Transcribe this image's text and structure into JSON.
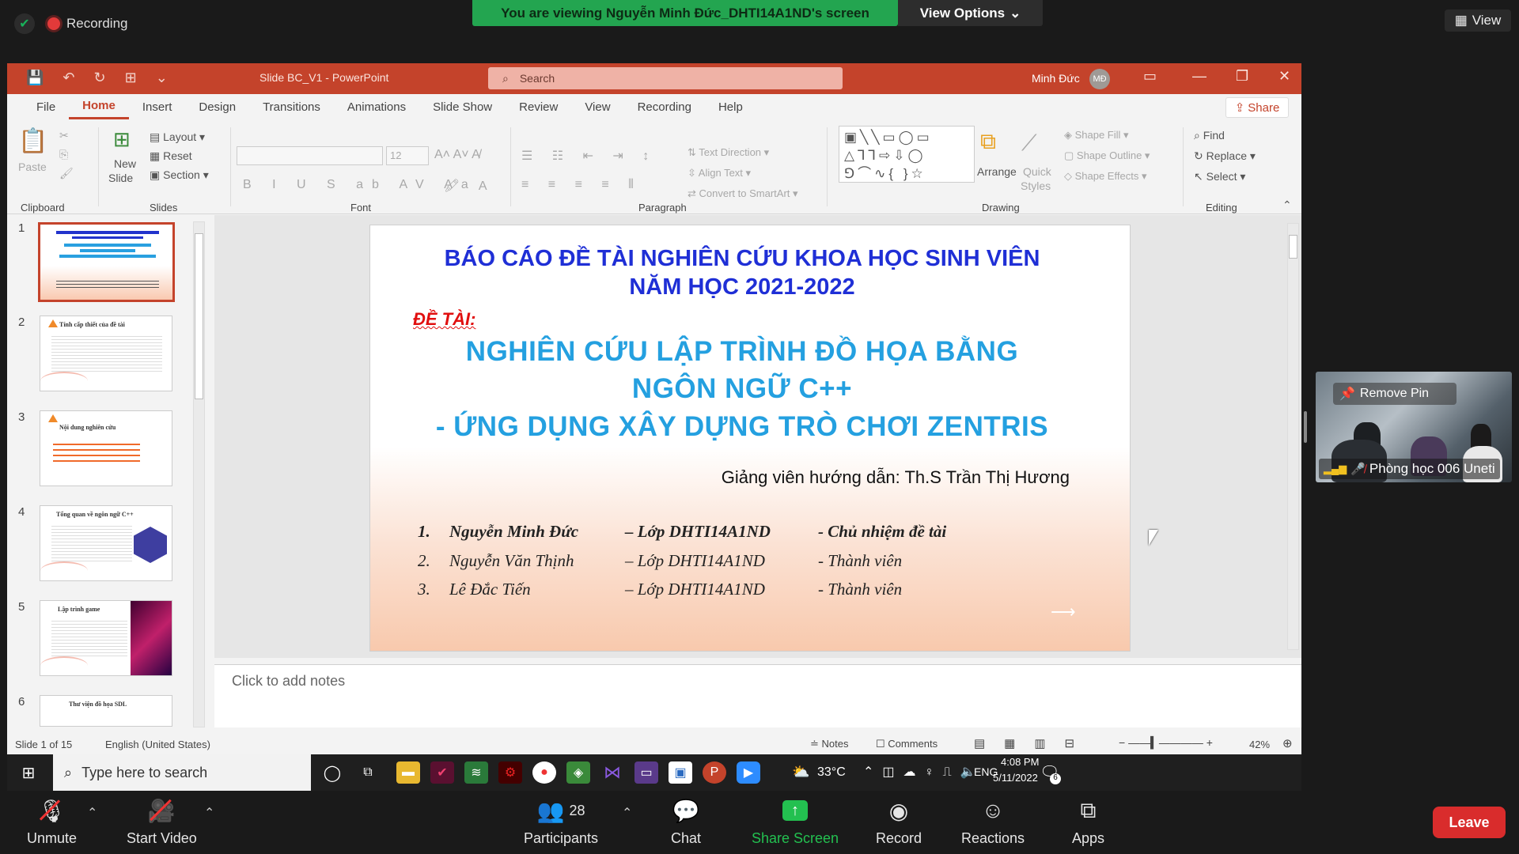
{
  "zoom": {
    "recording_label": "Recording",
    "banner": "You are viewing Nguyễn Minh Đức_DHTI14A1ND's screen",
    "view_options": "View Options",
    "view_label": "View",
    "leave": "Leave",
    "participants_count": "28",
    "controls": {
      "unmute": "Unmute",
      "start_video": "Start Video",
      "participants": "Participants",
      "chat": "Chat",
      "share_screen": "Share Screen",
      "record": "Record",
      "reactions": "Reactions",
      "apps": "Apps"
    },
    "video_tile": {
      "remove_pin": "Remove Pin",
      "name": "Phòng học 006 Uneti"
    }
  },
  "ppt": {
    "doc_title": "Slide BC_V1  -  PowerPoint",
    "search_placeholder": "Search",
    "user_name": "Minh Đức",
    "user_initials": "MĐ",
    "tabs": [
      "File",
      "Home",
      "Insert",
      "Design",
      "Transitions",
      "Animations",
      "Slide Show",
      "Review",
      "View",
      "Recording",
      "Help"
    ],
    "share": "Share",
    "ribbon": {
      "paste": "Paste",
      "new_slide": "New",
      "new_slide2": "Slide",
      "layout": "Layout",
      "reset": "Reset",
      "section": "Section",
      "font_size": "12",
      "text_direction": "Text Direction",
      "align_text": "Align Text",
      "convert_smartart": "Convert to SmartArt",
      "arrange": "Arrange",
      "quick_styles": "Quick",
      "quick_styles2": "Styles",
      "shape_fill": "Shape Fill",
      "shape_outline": "Shape Outline",
      "shape_effects": "Shape Effects",
      "find": "Find",
      "replace": "Replace",
      "select": "Select",
      "groups": [
        "Clipboard",
        "Slides",
        "Font",
        "Paragraph",
        "Drawing",
        "Editing"
      ]
    },
    "thumbnails": [
      {
        "num": "1",
        "title": ""
      },
      {
        "num": "2",
        "title": "Tính cấp thiết của đề tài"
      },
      {
        "num": "3",
        "title": "Nội dung nghiên cứu"
      },
      {
        "num": "4",
        "title": "Tổng quan về ngôn ngữ C++"
      },
      {
        "num": "5",
        "title": "Lập trình game"
      },
      {
        "num": "6",
        "title": "Thư viện đồ họa SDL"
      }
    ],
    "slide": {
      "heading1": "BÁO CÁO ĐỀ TÀI NGHIÊN CỨU KHOA HỌC SINH VIÊN",
      "heading2": "NĂM HỌC 2021-2022",
      "de_tai": "ĐỀ TÀI:",
      "topic1": "NGHIÊN CỨU LẬP TRÌNH ĐỒ HỌA BẰNG",
      "topic2": "NGÔN NGỮ C++",
      "topic3": "- ỨNG DỤNG XÂY DỰNG TRÒ CHƠI ZENTRIS",
      "advisor": "Giảng viên hướng dẫn: Th.S Trần Thị Hương",
      "members": [
        {
          "num": "1.",
          "name": "Nguyễn Minh Đức",
          "class": "– Lớp DHTI14A1ND",
          "role": "- Chủ nhiệm đề tài"
        },
        {
          "num": "2.",
          "name": "Nguyễn Văn Thịnh",
          "class": "– Lớp DHTI14A1ND",
          "role": "- Thành viên"
        },
        {
          "num": "3.",
          "name": "Lê Đắc Tiến",
          "class": "– Lớp DHTI14A1ND",
          "role": "- Thành viên"
        }
      ]
    },
    "notes_placeholder": "Click to add notes",
    "status": {
      "slide_of": "Slide 1 of 15",
      "language": "English (United States)",
      "notes": "Notes",
      "comments": "Comments",
      "zoom": "42%"
    }
  },
  "taskbar": {
    "search_placeholder": "Type here to search",
    "temperature": "33°C",
    "lang": "ENG",
    "time": "4:08 PM",
    "date": "5/11/2022",
    "notif_count": "6"
  }
}
